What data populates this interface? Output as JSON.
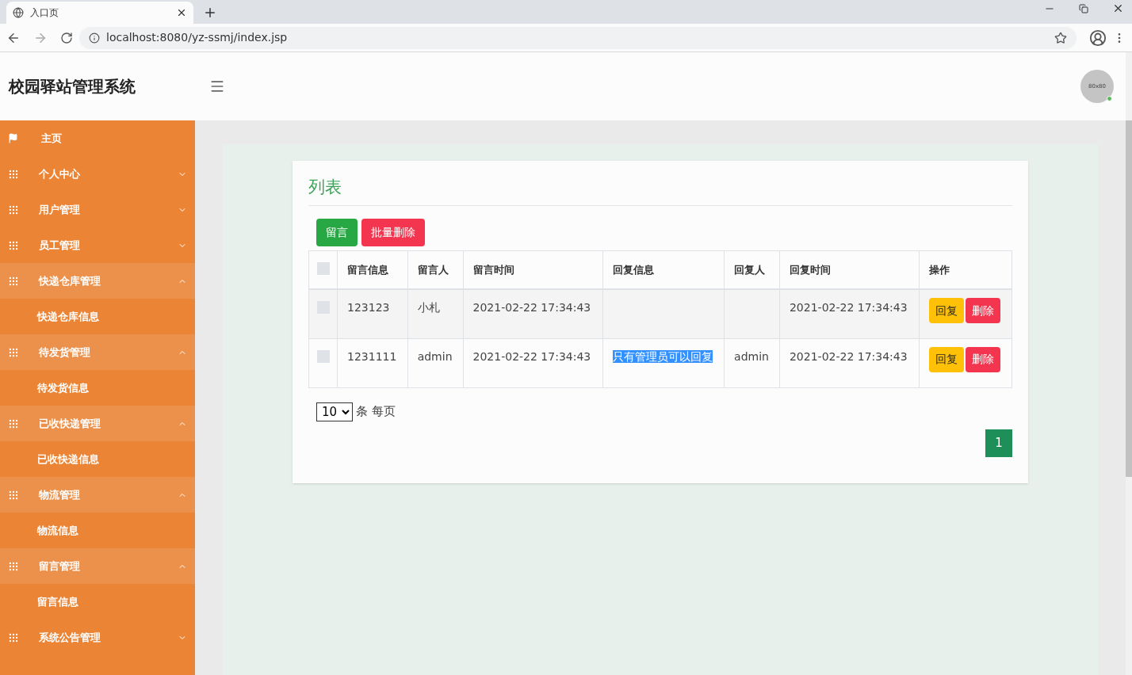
{
  "browser": {
    "tab_title": "入口页",
    "url": "localhost:8080/yz-ssmj/index.jsp"
  },
  "header": {
    "title": "校园驿站管理系统",
    "avatar_text": "80x80",
    "online": true
  },
  "sidebar": {
    "items": [
      {
        "kind": "home",
        "label": "主页"
      },
      {
        "kind": "group",
        "label": "个人中心",
        "expanded": false
      },
      {
        "kind": "group",
        "label": "用户管理",
        "expanded": false
      },
      {
        "kind": "group",
        "label": "员工管理",
        "expanded": false
      },
      {
        "kind": "group",
        "label": "快递仓库管理",
        "expanded": true,
        "children": [
          {
            "label": "快递仓库信息"
          }
        ]
      },
      {
        "kind": "group",
        "label": "待发货管理",
        "expanded": true,
        "children": [
          {
            "label": "待发货信息"
          }
        ]
      },
      {
        "kind": "group",
        "label": "已收快递管理",
        "expanded": true,
        "children": [
          {
            "label": "已收快递信息"
          }
        ]
      },
      {
        "kind": "group",
        "label": "物流管理",
        "expanded": true,
        "children": [
          {
            "label": "物流信息"
          }
        ]
      },
      {
        "kind": "group",
        "label": "留言管理",
        "expanded": true,
        "children": [
          {
            "label": "留言信息"
          }
        ]
      },
      {
        "kind": "group",
        "label": "系统公告管理",
        "expanded": false
      }
    ]
  },
  "card": {
    "title": "列表",
    "buttons": [
      {
        "kind": "add",
        "label": "留言"
      },
      {
        "kind": "delete",
        "label": "批量删除"
      }
    ],
    "table": {
      "select_all_checked": false,
      "columns": [
        "留言信息",
        "留言人",
        "留言时间",
        "回复信息",
        "回复人",
        "回复时间",
        "操作"
      ],
      "rows": [
        {
          "checked": false,
          "cells": [
            "123123",
            "小札",
            "2021-02-22 17:34:43",
            "",
            "",
            "2021-02-22 17:34:43"
          ],
          "actions": [
            "回复",
            "删除"
          ]
        },
        {
          "checked": false,
          "cells": [
            "1231111",
            "admin",
            "2021-02-22 17:34:43",
            "只有管理员可以回复",
            "admin",
            "2021-02-22 17:34:43"
          ],
          "reply_highlighted": true,
          "actions": [
            "回复",
            "删除"
          ]
        }
      ]
    },
    "page_size": "10",
    "page_size_label": "条 每页",
    "pages": [
      {
        "label": "1",
        "selected": true
      }
    ]
  }
}
